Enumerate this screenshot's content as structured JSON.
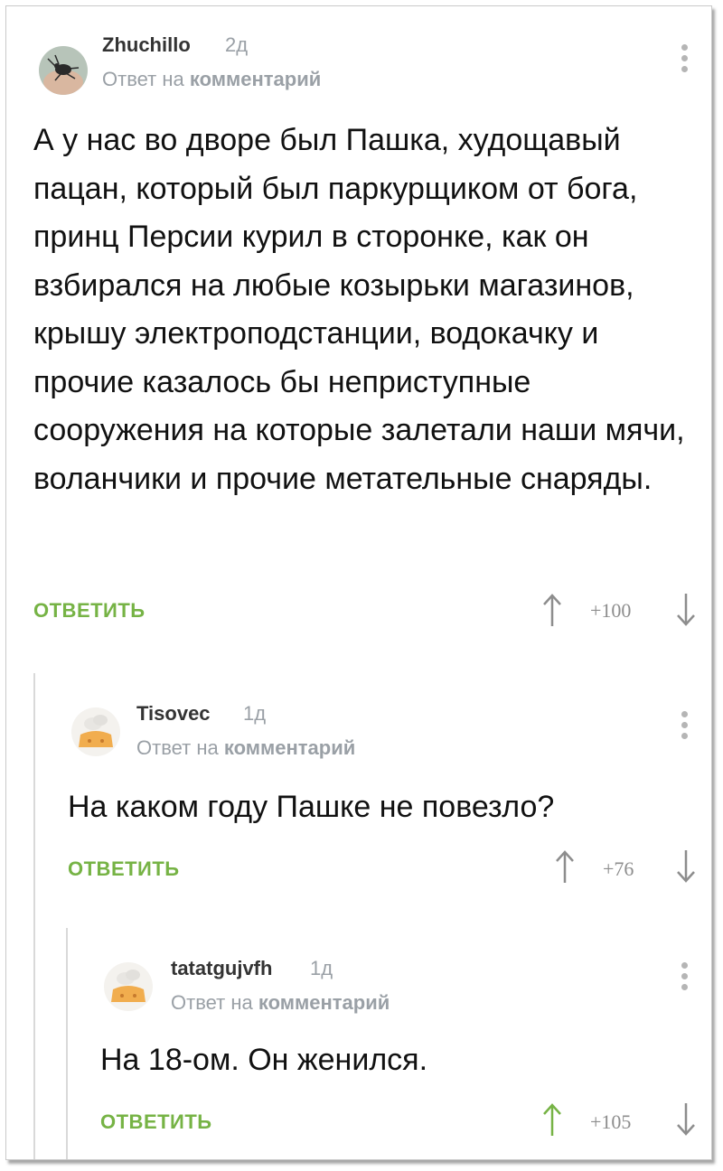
{
  "comments": [
    {
      "username": "Zhuchillo",
      "time": "2д",
      "reply_prefix": "Ответ на",
      "reply_target": "комментарий",
      "text": "А у нас во дворе был Пашка, худощавый пацан, который был паркурщиком от бога, принц Персии курил в сторонке, как он взбирался на любые козырьки магазинов, крышу электроподстанции, водокачку и прочие казалось бы неприступные сооружения на которые залетали наши мячи, воланчики и прочие метательные снаряды.",
      "reply_label": "ОТВЕТИТЬ",
      "score": "+100",
      "upvoted": false
    },
    {
      "username": "Tisovec",
      "time": "1д",
      "reply_prefix": "Ответ на",
      "reply_target": "комментарий",
      "text": "На каком году Пашке не повезло?",
      "reply_label": "ОТВЕТИТЬ",
      "score": "+76",
      "upvoted": false
    },
    {
      "username": "tatatgujvfh",
      "time": "1д",
      "reply_prefix": "Ответ на",
      "reply_target": "комментарий",
      "text": "На 18-ом. Он женился.",
      "reply_label": "ОТВЕТИТЬ",
      "score": "+105",
      "upvoted": true
    }
  ],
  "colors": {
    "accent_green": "#76b345",
    "muted_gray": "#9aa0a6",
    "arrow_gray": "#8d8d8d"
  },
  "icons": {
    "menu": "vertical-dots-icon",
    "upvote": "arrow-up-icon",
    "downvote": "arrow-down-icon"
  }
}
